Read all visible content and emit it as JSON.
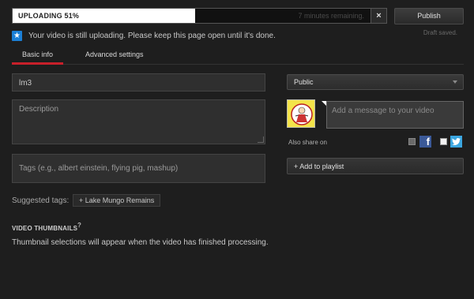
{
  "upload": {
    "status_label": "UPLOADING 51%",
    "progress_fraction": 0.51,
    "remaining": "7 minutes remaining.",
    "cancel_label": "×"
  },
  "actions": {
    "publish_label": "Publish",
    "draft_status": "Draft saved."
  },
  "notice": {
    "icon": "star-icon",
    "text": "Your video is still uploading. Please keep this page open until it's done."
  },
  "tabs": [
    {
      "label": "Basic info",
      "active": true
    },
    {
      "label": "Advanced settings",
      "active": false
    }
  ],
  "form": {
    "title_value": "lm3",
    "description_placeholder": "Description",
    "tags_placeholder": "Tags (e.g., albert einstein, flying pig, mashup)",
    "suggested_label": "Suggested tags:",
    "suggested_tags": [
      "+ Lake Mungo Remains"
    ]
  },
  "thumbnails": {
    "title": "VIDEO THUMBNAILS",
    "help": "?",
    "note": "Thumbnail selections will appear when the video has finished processing."
  },
  "sidebar": {
    "privacy_value": "Public",
    "message_placeholder": "Add a message to your video",
    "also_share_label": "Also share on",
    "share_services": [
      "facebook-icon",
      "twitter-icon"
    ],
    "add_to_playlist_label": "+ Add to playlist"
  },
  "colors": {
    "background": "#1e1e1e",
    "accent_red": "#c8202a",
    "notice_blue": "#1b7fd6",
    "facebook": "#3b5998",
    "twitter": "#3ba6e0"
  }
}
